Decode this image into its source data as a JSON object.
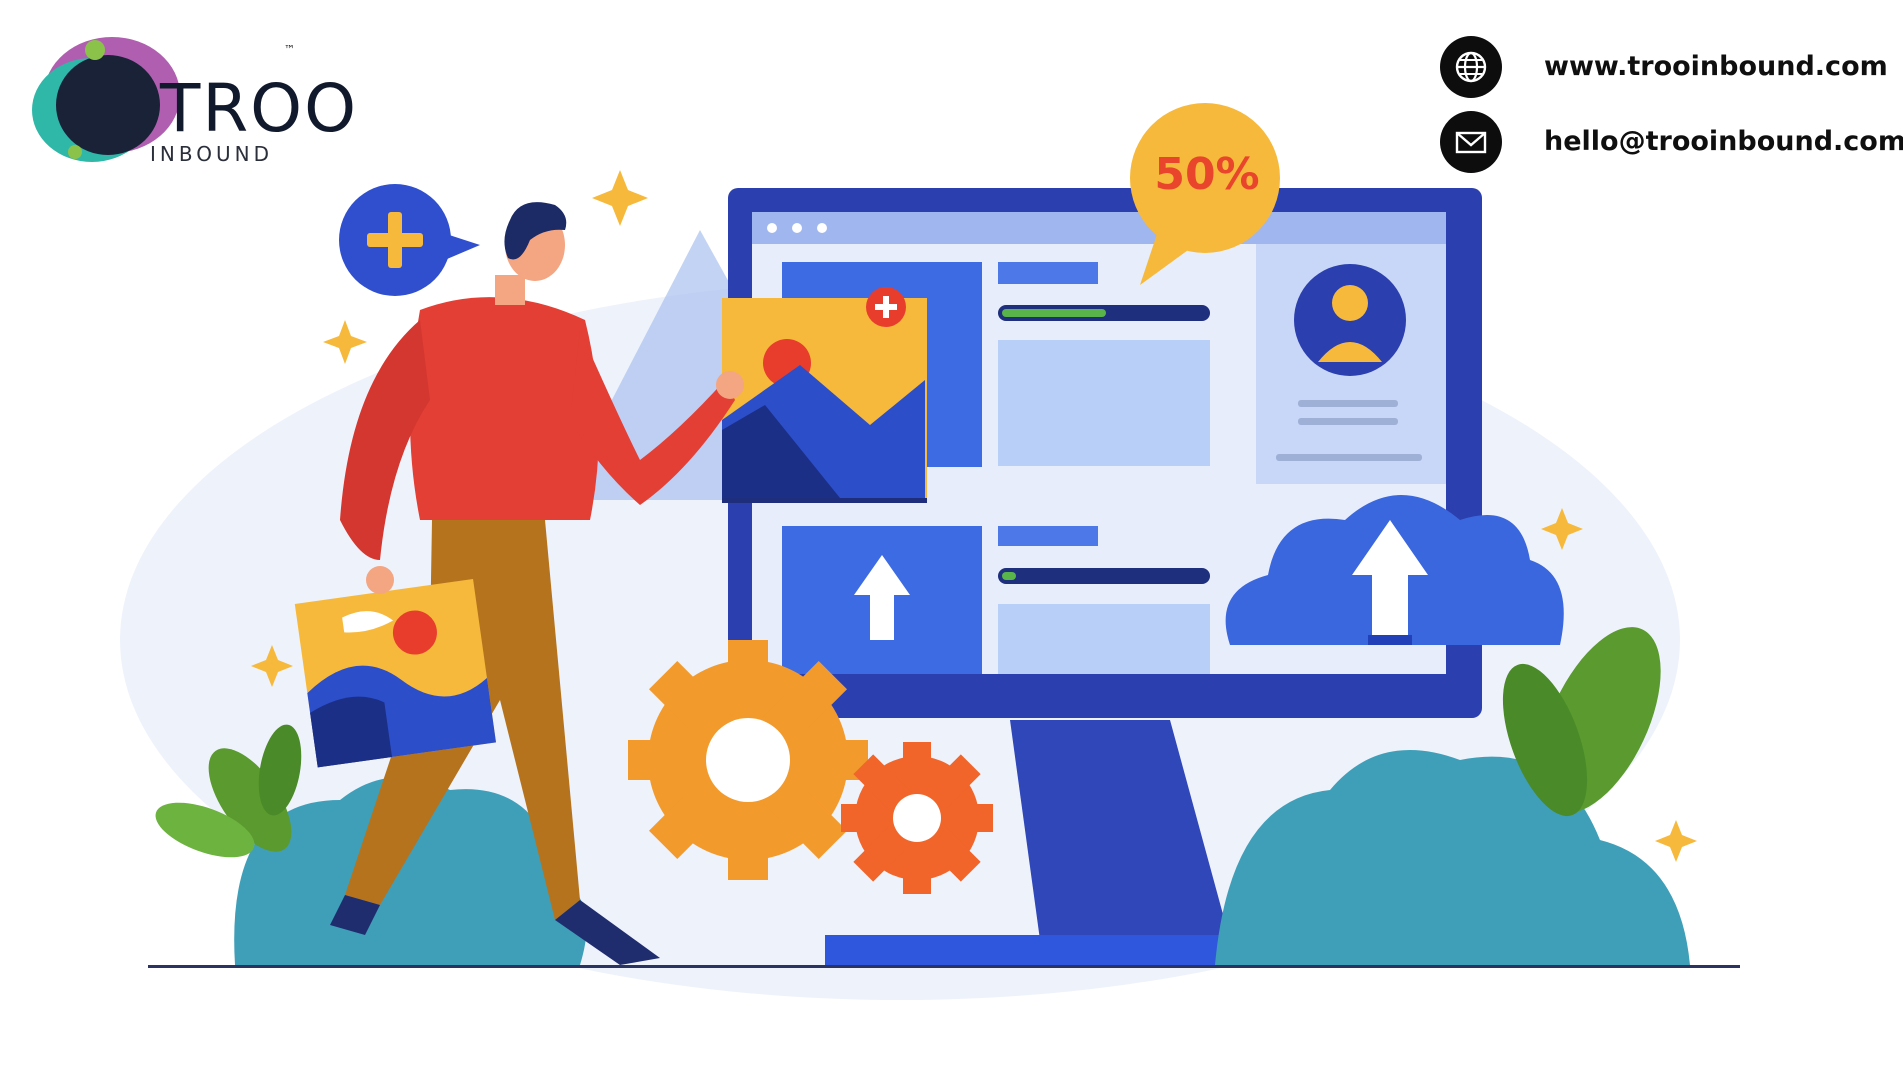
{
  "brand": {
    "wordmark": "TROO",
    "subtext": "INBOUND",
    "trademark": "™"
  },
  "contacts": [
    {
      "icon": "globe-icon",
      "text": "www.trooinbound.com"
    },
    {
      "icon": "mail-icon",
      "text": "hello@trooinbound.com"
    }
  ],
  "illustration": {
    "progress_badge": "50%"
  },
  "colors": {
    "primary_blue": "#2b49c4",
    "accent_red": "#e8452c",
    "accent_yellow": "#f6b93b",
    "leaf_green": "#5a9a2f",
    "teal": "#39a0b8"
  }
}
